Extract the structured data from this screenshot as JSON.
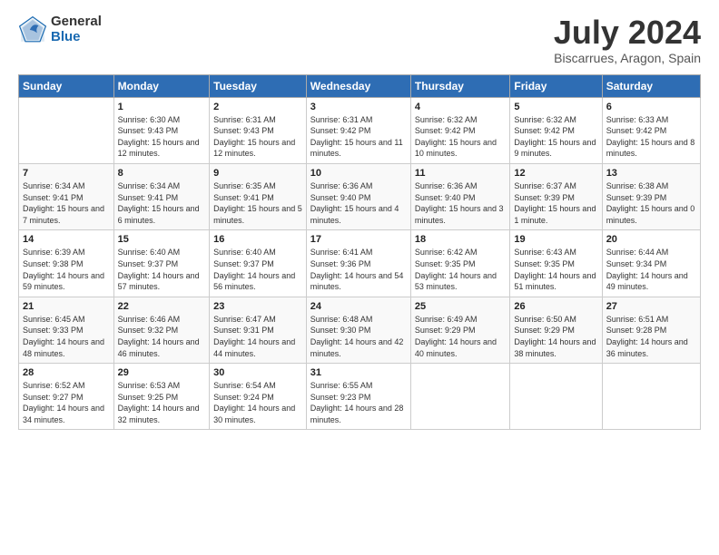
{
  "header": {
    "logo_general": "General",
    "logo_blue": "Blue",
    "title": "July 2024",
    "subtitle": "Biscarrues, Aragon, Spain"
  },
  "columns": [
    "Sunday",
    "Monday",
    "Tuesday",
    "Wednesday",
    "Thursday",
    "Friday",
    "Saturday"
  ],
  "weeks": [
    [
      {
        "day": "",
        "sunrise": "",
        "sunset": "",
        "daylight": ""
      },
      {
        "day": "1",
        "sunrise": "Sunrise: 6:30 AM",
        "sunset": "Sunset: 9:43 PM",
        "daylight": "Daylight: 15 hours and 12 minutes."
      },
      {
        "day": "2",
        "sunrise": "Sunrise: 6:31 AM",
        "sunset": "Sunset: 9:43 PM",
        "daylight": "Daylight: 15 hours and 12 minutes."
      },
      {
        "day": "3",
        "sunrise": "Sunrise: 6:31 AM",
        "sunset": "Sunset: 9:42 PM",
        "daylight": "Daylight: 15 hours and 11 minutes."
      },
      {
        "day": "4",
        "sunrise": "Sunrise: 6:32 AM",
        "sunset": "Sunset: 9:42 PM",
        "daylight": "Daylight: 15 hours and 10 minutes."
      },
      {
        "day": "5",
        "sunrise": "Sunrise: 6:32 AM",
        "sunset": "Sunset: 9:42 PM",
        "daylight": "Daylight: 15 hours and 9 minutes."
      },
      {
        "day": "6",
        "sunrise": "Sunrise: 6:33 AM",
        "sunset": "Sunset: 9:42 PM",
        "daylight": "Daylight: 15 hours and 8 minutes."
      }
    ],
    [
      {
        "day": "7",
        "sunrise": "Sunrise: 6:34 AM",
        "sunset": "Sunset: 9:41 PM",
        "daylight": "Daylight: 15 hours and 7 minutes."
      },
      {
        "day": "8",
        "sunrise": "Sunrise: 6:34 AM",
        "sunset": "Sunset: 9:41 PM",
        "daylight": "Daylight: 15 hours and 6 minutes."
      },
      {
        "day": "9",
        "sunrise": "Sunrise: 6:35 AM",
        "sunset": "Sunset: 9:41 PM",
        "daylight": "Daylight: 15 hours and 5 minutes."
      },
      {
        "day": "10",
        "sunrise": "Sunrise: 6:36 AM",
        "sunset": "Sunset: 9:40 PM",
        "daylight": "Daylight: 15 hours and 4 minutes."
      },
      {
        "day": "11",
        "sunrise": "Sunrise: 6:36 AM",
        "sunset": "Sunset: 9:40 PM",
        "daylight": "Daylight: 15 hours and 3 minutes."
      },
      {
        "day": "12",
        "sunrise": "Sunrise: 6:37 AM",
        "sunset": "Sunset: 9:39 PM",
        "daylight": "Daylight: 15 hours and 1 minute."
      },
      {
        "day": "13",
        "sunrise": "Sunrise: 6:38 AM",
        "sunset": "Sunset: 9:39 PM",
        "daylight": "Daylight: 15 hours and 0 minutes."
      }
    ],
    [
      {
        "day": "14",
        "sunrise": "Sunrise: 6:39 AM",
        "sunset": "Sunset: 9:38 PM",
        "daylight": "Daylight: 14 hours and 59 minutes."
      },
      {
        "day": "15",
        "sunrise": "Sunrise: 6:40 AM",
        "sunset": "Sunset: 9:37 PM",
        "daylight": "Daylight: 14 hours and 57 minutes."
      },
      {
        "day": "16",
        "sunrise": "Sunrise: 6:40 AM",
        "sunset": "Sunset: 9:37 PM",
        "daylight": "Daylight: 14 hours and 56 minutes."
      },
      {
        "day": "17",
        "sunrise": "Sunrise: 6:41 AM",
        "sunset": "Sunset: 9:36 PM",
        "daylight": "Daylight: 14 hours and 54 minutes."
      },
      {
        "day": "18",
        "sunrise": "Sunrise: 6:42 AM",
        "sunset": "Sunset: 9:35 PM",
        "daylight": "Daylight: 14 hours and 53 minutes."
      },
      {
        "day": "19",
        "sunrise": "Sunrise: 6:43 AM",
        "sunset": "Sunset: 9:35 PM",
        "daylight": "Daylight: 14 hours and 51 minutes."
      },
      {
        "day": "20",
        "sunrise": "Sunrise: 6:44 AM",
        "sunset": "Sunset: 9:34 PM",
        "daylight": "Daylight: 14 hours and 49 minutes."
      }
    ],
    [
      {
        "day": "21",
        "sunrise": "Sunrise: 6:45 AM",
        "sunset": "Sunset: 9:33 PM",
        "daylight": "Daylight: 14 hours and 48 minutes."
      },
      {
        "day": "22",
        "sunrise": "Sunrise: 6:46 AM",
        "sunset": "Sunset: 9:32 PM",
        "daylight": "Daylight: 14 hours and 46 minutes."
      },
      {
        "day": "23",
        "sunrise": "Sunrise: 6:47 AM",
        "sunset": "Sunset: 9:31 PM",
        "daylight": "Daylight: 14 hours and 44 minutes."
      },
      {
        "day": "24",
        "sunrise": "Sunrise: 6:48 AM",
        "sunset": "Sunset: 9:30 PM",
        "daylight": "Daylight: 14 hours and 42 minutes."
      },
      {
        "day": "25",
        "sunrise": "Sunrise: 6:49 AM",
        "sunset": "Sunset: 9:29 PM",
        "daylight": "Daylight: 14 hours and 40 minutes."
      },
      {
        "day": "26",
        "sunrise": "Sunrise: 6:50 AM",
        "sunset": "Sunset: 9:29 PM",
        "daylight": "Daylight: 14 hours and 38 minutes."
      },
      {
        "day": "27",
        "sunrise": "Sunrise: 6:51 AM",
        "sunset": "Sunset: 9:28 PM",
        "daylight": "Daylight: 14 hours and 36 minutes."
      }
    ],
    [
      {
        "day": "28",
        "sunrise": "Sunrise: 6:52 AM",
        "sunset": "Sunset: 9:27 PM",
        "daylight": "Daylight: 14 hours and 34 minutes."
      },
      {
        "day": "29",
        "sunrise": "Sunrise: 6:53 AM",
        "sunset": "Sunset: 9:25 PM",
        "daylight": "Daylight: 14 hours and 32 minutes."
      },
      {
        "day": "30",
        "sunrise": "Sunrise: 6:54 AM",
        "sunset": "Sunset: 9:24 PM",
        "daylight": "Daylight: 14 hours and 30 minutes."
      },
      {
        "day": "31",
        "sunrise": "Sunrise: 6:55 AM",
        "sunset": "Sunset: 9:23 PM",
        "daylight": "Daylight: 14 hours and 28 minutes."
      },
      {
        "day": "",
        "sunrise": "",
        "sunset": "",
        "daylight": ""
      },
      {
        "day": "",
        "sunrise": "",
        "sunset": "",
        "daylight": ""
      },
      {
        "day": "",
        "sunrise": "",
        "sunset": "",
        "daylight": ""
      }
    ]
  ]
}
